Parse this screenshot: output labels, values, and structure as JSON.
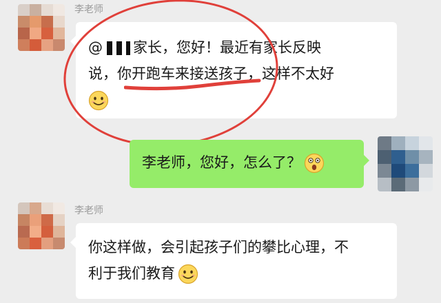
{
  "chat": {
    "messages": [
      {
        "sender": "李老师",
        "side": "left",
        "line1_prefix": "@",
        "line1_text": "家长，您好！最近有家长反映",
        "line2_text": "说，你开跑车来接送孩子，这样不太好",
        "emoji": "smile-emoji"
      },
      {
        "side": "right",
        "text": "李老师，您好，怎么了？",
        "emoji": "shocked-emoji"
      },
      {
        "sender": "李老师",
        "side": "left",
        "line1_text": "你这样做，会引起孩子们的攀比心理，不",
        "line2_text": "利于我们教育",
        "emoji": "smile-emoji"
      }
    ]
  },
  "colors": {
    "background": "#ededed",
    "received_bubble": "#ffffff",
    "sent_bubble": "#95ec69",
    "annotation_red": "#e0403a"
  }
}
